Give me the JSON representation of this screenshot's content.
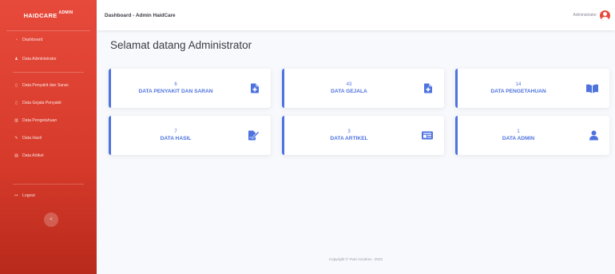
{
  "sidebar": {
    "brand": {
      "name": "HAIDCARE",
      "suffix": "ADMIN"
    },
    "items": [
      {
        "label": "Dashboard",
        "icon": "tachometer-icon"
      },
      {
        "label": "Data Administrator",
        "icon": "user-icon"
      },
      {
        "label": "Data Penyakit dan Saran",
        "icon": "file-icon"
      },
      {
        "label": "Data Gejala Penyakit",
        "icon": "file-icon"
      },
      {
        "label": "Data Pengetahuan",
        "icon": "book-icon"
      },
      {
        "label": "Data Hasil",
        "icon": "file-signature-icon"
      },
      {
        "label": "Data Artikel",
        "icon": "newspaper-icon"
      },
      {
        "label": "Logout",
        "icon": "sign-out-icon"
      }
    ],
    "toggle_icon": "<"
  },
  "topbar": {
    "title": "Dashboard - Admin HaidCare",
    "user_name": "Administrator"
  },
  "main": {
    "heading": "Selamat datang Administrator",
    "cards": [
      {
        "count": "6",
        "label": "DATA PENYAKIT DAN SARAN",
        "icon": "file-medical-icon"
      },
      {
        "count": "43",
        "label": "DATA GEJALA",
        "icon": "file-medical-icon"
      },
      {
        "count": "14",
        "label": "DATA PENGETAHUAN",
        "icon": "book-open-icon"
      },
      {
        "count": "7",
        "label": "DATA HASIL",
        "icon": "file-signature-icon"
      },
      {
        "count": "3",
        "label": "DATA ARTIKEL",
        "icon": "newspaper-icon"
      },
      {
        "count": "1",
        "label": "DATA ADMIN",
        "icon": "user-icon"
      }
    ]
  },
  "footer": {
    "text": "Copyright © Putri Azzahra - 2022"
  },
  "colors": {
    "sidebar": "#e74a3b",
    "primary": "#4e73df",
    "background": "#f8f9fc"
  }
}
